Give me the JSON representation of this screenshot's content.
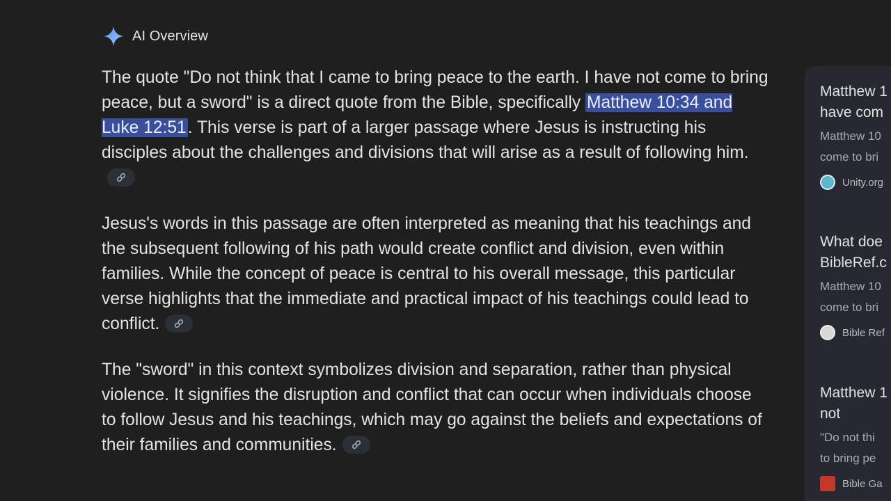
{
  "overview": {
    "label": "AI Overview"
  },
  "paragraphs": [
    {
      "before": "The quote \"Do not think that I came to bring peace to the earth. I have not come to bring peace, but a sword\" is a direct quote from the Bible, specifically ",
      "highlight": "Matthew 10:34 and Luke 12:51",
      "after": ". This verse is part of a larger passage where Jesus is instructing his disciples about the challenges and divisions that will arise as a result of following him."
    },
    {
      "text": "Jesus's words in this passage are often interpreted as meaning that his teachings and the subsequent following of his path would create conflict and division, even within families. While the concept of peace is central to his overall message, this particular verse highlights that the immediate and practical impact of his teachings could lead to conflict."
    },
    {
      "text": "The \"sword\" in this context symbolizes division and separation, rather than physical violence. It signifies the disruption and conflict that can occur when individuals choose to follow Jesus and his teachings, which may go against the beliefs and expectations of their families and communities."
    }
  ],
  "sources": [
    {
      "title_line1": "Matthew 1",
      "title_line2": "have com",
      "snippet_line1": "Matthew 10",
      "snippet_line2": "come to bri",
      "site": "Unity.org",
      "favicon_color": "#5fb6c9"
    },
    {
      "title_line1": "What doe",
      "title_line2": "BibleRef.c",
      "snippet_line1": "Matthew 10",
      "snippet_line2": "come to bri",
      "site": "Bible Ref",
      "favicon_color": "#d7d7d7"
    },
    {
      "title_line1": "Matthew 1",
      "title_line2": "not",
      "snippet_line1": "\"Do not thi",
      "snippet_line2": "to bring pe",
      "site": "Bible Ga",
      "favicon_color": "#c0392b"
    }
  ],
  "icons": {
    "spark": "sparkle-icon",
    "link": "link-icon"
  },
  "colors": {
    "background": "#1f1f1f",
    "text": "#e3e3e3",
    "highlight": "#3a4f99",
    "spark_blue": "#8ab4f8"
  }
}
